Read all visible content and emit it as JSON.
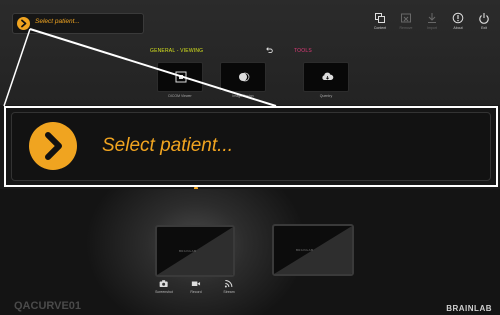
{
  "header": {
    "patient_selector_label": "Select patient..."
  },
  "toolbar": {
    "buttons": [
      {
        "label": "Content",
        "icon": "content-icon",
        "enabled": true
      },
      {
        "label": "Remove",
        "icon": "remove-icon",
        "enabled": false
      },
      {
        "label": "Import",
        "icon": "import-icon",
        "enabled": false
      },
      {
        "label": "About",
        "icon": "info-icon",
        "enabled": true
      },
      {
        "label": "Exit",
        "icon": "power-icon",
        "enabled": true
      }
    ]
  },
  "sections": {
    "general_viewing": "GENERAL - VIEWING",
    "tools": "TOOLS"
  },
  "tiles": [
    {
      "label": "DICOM Viewer",
      "icon": "dicom-viewer-icon"
    },
    {
      "label": "Image Fusion",
      "icon": "image-fusion-icon"
    },
    {
      "label": "Quentry",
      "icon": "cloud-icon"
    }
  ],
  "zoom": {
    "label": "Select patient..."
  },
  "recording": {
    "buttons": [
      {
        "label": "Screenshot",
        "icon": "camera-icon"
      },
      {
        "label": "Record",
        "icon": "video-icon"
      },
      {
        "label": "Stream",
        "icon": "stream-icon"
      }
    ]
  },
  "monitors": [
    {
      "brand": "BRAINLAB"
    },
    {
      "brand": "BRAINLAB"
    }
  ],
  "footer": {
    "station_name": "QACURVE01",
    "brand": "BRAINLAB"
  },
  "colors": {
    "accent": "#f0a420",
    "general_label": "#d6e31d",
    "tools_label": "#e23b7a",
    "background": "#1a1a1a"
  }
}
